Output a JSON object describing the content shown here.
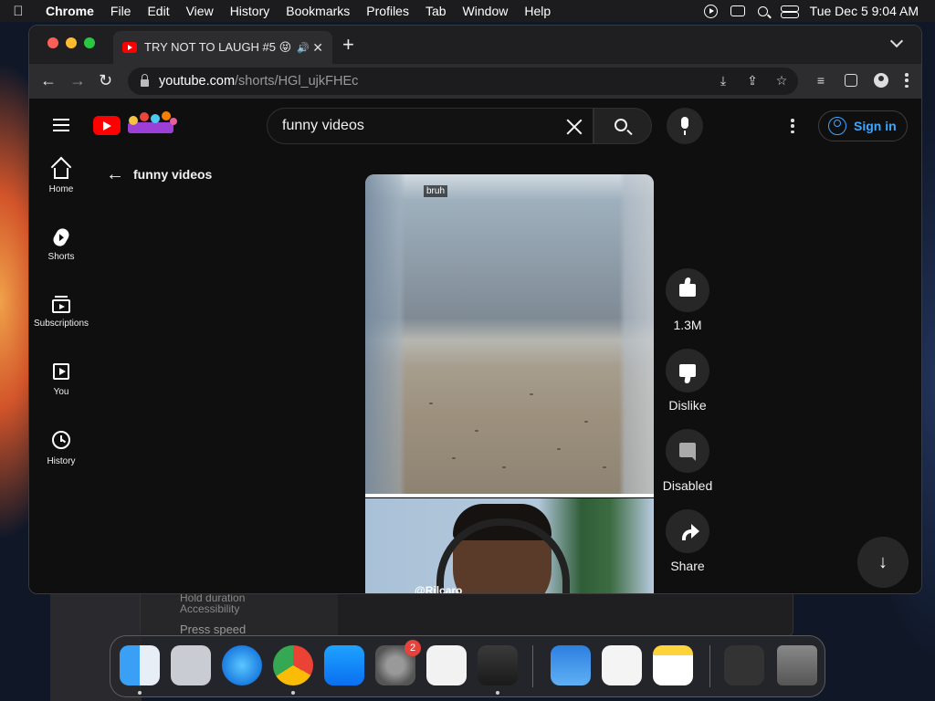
{
  "menubar": {
    "app_name": "Chrome",
    "menus": [
      "File",
      "Edit",
      "View",
      "History",
      "Bookmarks",
      "Profiles",
      "Tab",
      "Window",
      "Help"
    ],
    "clock": "Tue Dec 5  9:04 AM"
  },
  "browser": {
    "tab": {
      "title": "TRY NOT TO LAUGH #5 😝",
      "audio_icon": "🔊"
    },
    "url_host": "youtube.com",
    "url_path": "/shorts/HGl_ujkFHEc"
  },
  "youtube": {
    "search_value": "funny videos",
    "sign_in_label": "Sign in",
    "back_label": "funny videos",
    "sidebar": [
      {
        "label": "Home",
        "icon": "home-icon"
      },
      {
        "label": "Shorts",
        "icon": "shorts-icon"
      },
      {
        "label": "Subscriptions",
        "icon": "subscriptions-icon"
      },
      {
        "label": "You",
        "icon": "you-icon"
      },
      {
        "label": "History",
        "icon": "history-icon"
      }
    ],
    "short": {
      "overlay_caption": "bruh",
      "channel_tag": "@Rilcaro"
    },
    "actions": {
      "like_count": "1.3M",
      "dislike_label": "Dislike",
      "comments_label": "Disabled",
      "share_label": "Share"
    }
  },
  "background": {
    "line1": "Hold duration",
    "line2": "Accessibility",
    "line3": "Press speed"
  },
  "dock": {
    "apps": [
      "Finder",
      "Launchpad",
      "Safari",
      "Google Chrome",
      "App Store",
      "System Settings",
      "TextEdit",
      "GarageBand",
      "Weather",
      "Preview",
      "Notes",
      "Screenshot",
      "Trash"
    ],
    "settings_badge": "2"
  },
  "colors": {
    "youtube_red": "#ff0000",
    "link_blue": "#3ea6ff",
    "badge_red": "#e5423b"
  }
}
